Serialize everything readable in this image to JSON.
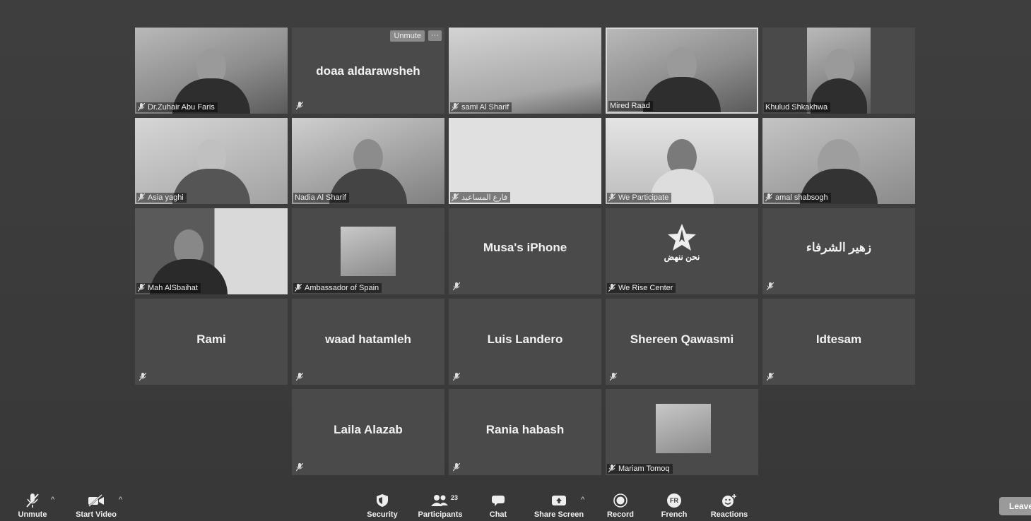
{
  "tiles": [
    {
      "name": "Dr.Zuhair Abu Faris",
      "kind": "video"
    },
    {
      "name": "doaa aldarawsheh",
      "kind": "name",
      "unmute": "Unmute",
      "more": "···"
    },
    {
      "name": "sami Al Sharif",
      "kind": "video"
    },
    {
      "name": "Mired Raad",
      "kind": "video",
      "active": true
    },
    {
      "name": "Khulud Shkakhwa",
      "kind": "video"
    },
    {
      "name": "Asia yaghi",
      "kind": "video"
    },
    {
      "name": "Nadia Al Sharif",
      "kind": "video"
    },
    {
      "name": "فارع المساعيد",
      "kind": "video"
    },
    {
      "name": "We Participate",
      "kind": "video"
    },
    {
      "name": "amal shabsogh",
      "kind": "video"
    },
    {
      "name": "Mah AlSbaihat",
      "kind": "video"
    },
    {
      "name": "Ambassador of Spain",
      "kind": "avatar"
    },
    {
      "name": "Musa's iPhone",
      "kind": "name"
    },
    {
      "name": "We Rise Center",
      "kind": "logo",
      "logo_text": "نحن ننهض"
    },
    {
      "name": "زهير الشرفاء",
      "kind": "name"
    },
    {
      "name": "Rami",
      "kind": "name"
    },
    {
      "name": "waad hatamleh",
      "kind": "name"
    },
    {
      "name": "Luis Landero",
      "kind": "name"
    },
    {
      "name": "Shereen Qawasmi",
      "kind": "name"
    },
    {
      "name": "Idtesam",
      "kind": "name"
    },
    {
      "name": "Laila Alazab",
      "kind": "name"
    },
    {
      "name": "Rania habash",
      "kind": "name"
    },
    {
      "name": "Mariam Tomoq",
      "kind": "avatar"
    }
  ],
  "toolbar": {
    "unmute": "Unmute",
    "start_video": "Start Video",
    "security": "Security",
    "participants": "Participants",
    "participants_count": "23",
    "chat": "Chat",
    "share_screen": "Share Screen",
    "record": "Record",
    "language": "French",
    "language_badge": "FR",
    "reactions": "Reactions",
    "leave": "Leave"
  }
}
